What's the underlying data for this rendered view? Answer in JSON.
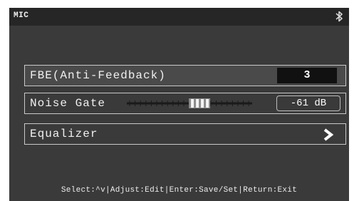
{
  "screen": {
    "title": "MIC",
    "status_icon": "bluetooth-icon"
  },
  "rows": {
    "fbe": {
      "label": "FBE(Anti-Feedback)",
      "value": "3"
    },
    "noise_gate": {
      "label": "Noise Gate",
      "value": "-61 dB",
      "slider_level": 0.58
    },
    "equalizer": {
      "label": "Equalizer",
      "arrow_icon": "chevron-right-icon"
    }
  },
  "footer": {
    "hint": "Select:^v|Adjust:Edit|Enter:Save/Set|Return:Exit"
  }
}
